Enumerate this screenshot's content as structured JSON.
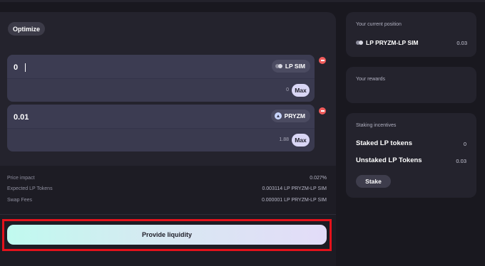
{
  "toolbar": {
    "optimize_label": "Optimize"
  },
  "inputs": [
    {
      "value": "0",
      "token": "LP SIM",
      "token_icon": "lp-pair-icon",
      "balance": "0",
      "max_label": "Max"
    },
    {
      "value": "0.01",
      "token": "PRYZM",
      "token_icon": "pryzm-icon",
      "balance": "1.88",
      "max_label": "Max"
    }
  ],
  "summary": {
    "price_impact_label": "Price impact",
    "price_impact_value": "0.027%",
    "expected_lp_label": "Expected LP Tokens",
    "expected_lp_value": "0.003114 LP PRYZM-LP SIM",
    "swap_fees_label": "Swap Fees",
    "swap_fees_value": "0.000001 LP PRYZM-LP SIM"
  },
  "provide_label": "Provide liquidity",
  "position": {
    "title": "Your current position",
    "token": "LP PRYZM-LP SIM",
    "amount": "0.03"
  },
  "rewards": {
    "title": "Your rewards"
  },
  "staking": {
    "title": "Staking incentives",
    "staked_label": "Staked LP tokens",
    "staked_value": "0",
    "unstaked_label": "Unstaked LP Tokens",
    "unstaked_value": "0.03",
    "stake_label": "Stake"
  },
  "colors": {
    "background": "#19181f",
    "card": "#24232d",
    "input": "#3a3a4f",
    "danger": "#ef5b5b",
    "highlight": "#e4121b"
  }
}
